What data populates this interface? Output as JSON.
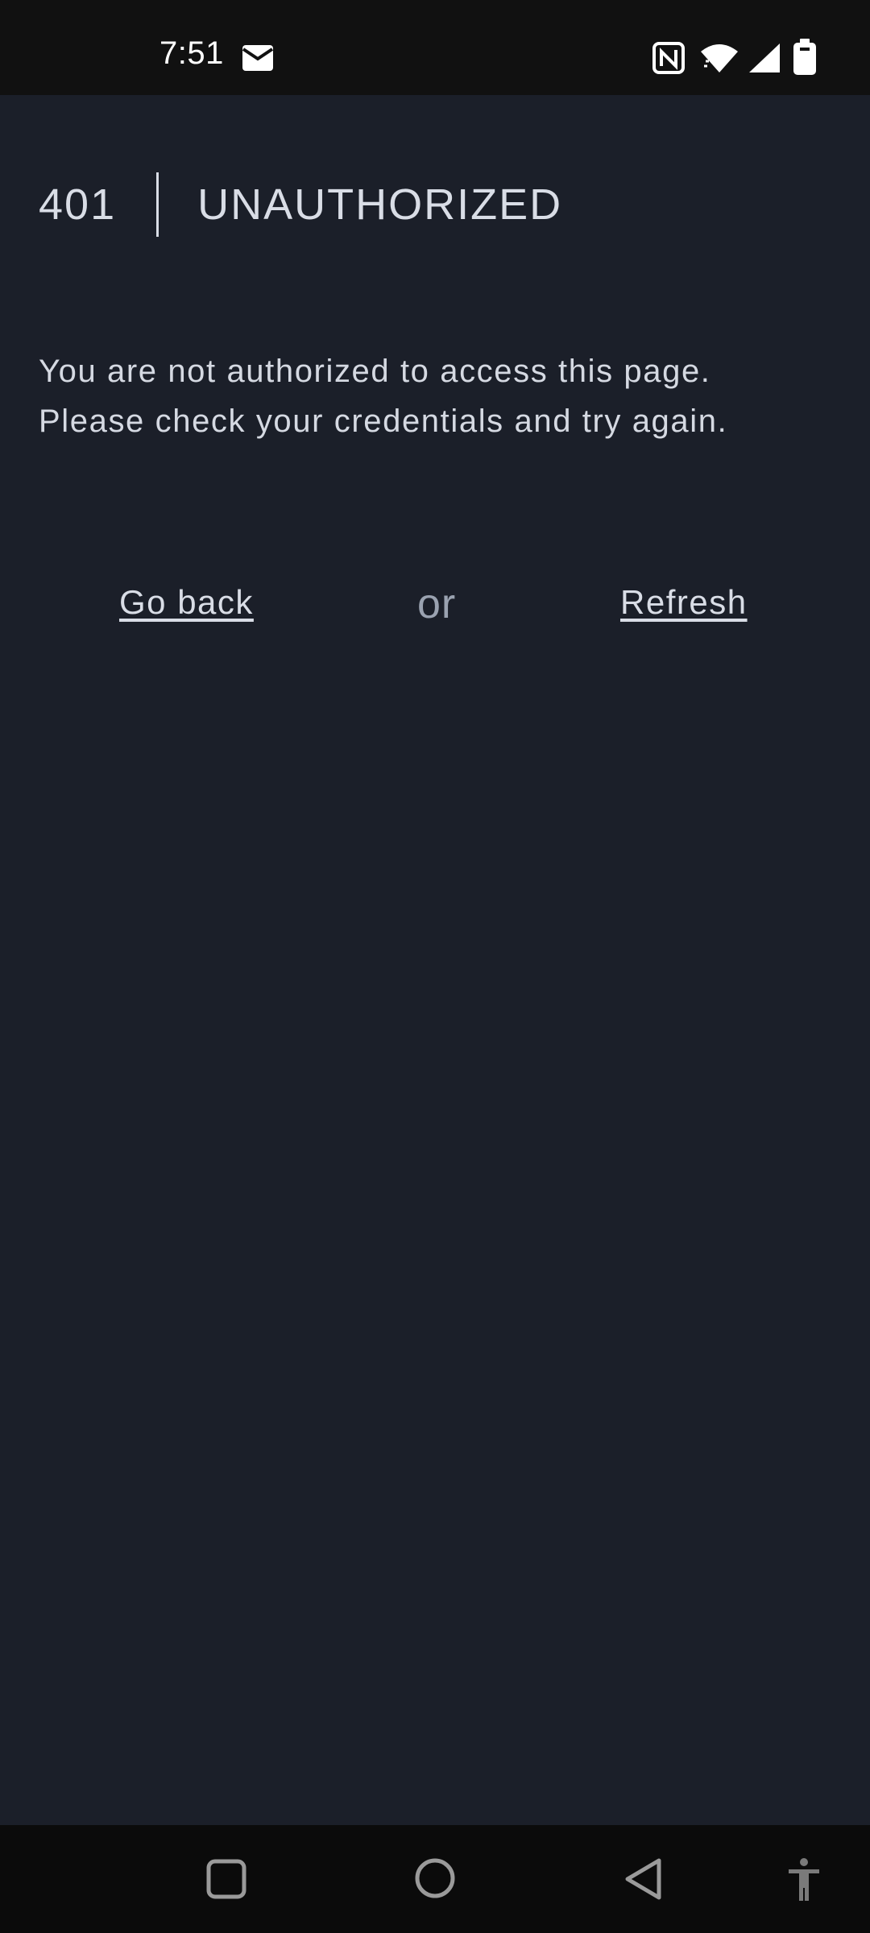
{
  "status_bar": {
    "time": "7:51",
    "icons": [
      "mail-icon",
      "nfc-icon",
      "wifi-icon",
      "cell-signal-icon",
      "battery-icon"
    ]
  },
  "error": {
    "code": "401",
    "title": "UNAUTHORIZED",
    "message_line1": "You are not authorized to access this page.",
    "message_line2": "Please check your credentials and try again."
  },
  "actions": {
    "go_back_label": "Go back",
    "separator": "or",
    "refresh_label": "Refresh"
  },
  "nav_bar": {
    "buttons": [
      "recents-square-icon",
      "home-circle-icon",
      "back-triangle-icon",
      "accessibility-icon"
    ]
  },
  "colors": {
    "background": "#1b1f29",
    "status_bar": "#111111",
    "nav_bar": "#0b0b0b",
    "text": "#d9dde6",
    "muted_text": "#9aa2b0"
  }
}
